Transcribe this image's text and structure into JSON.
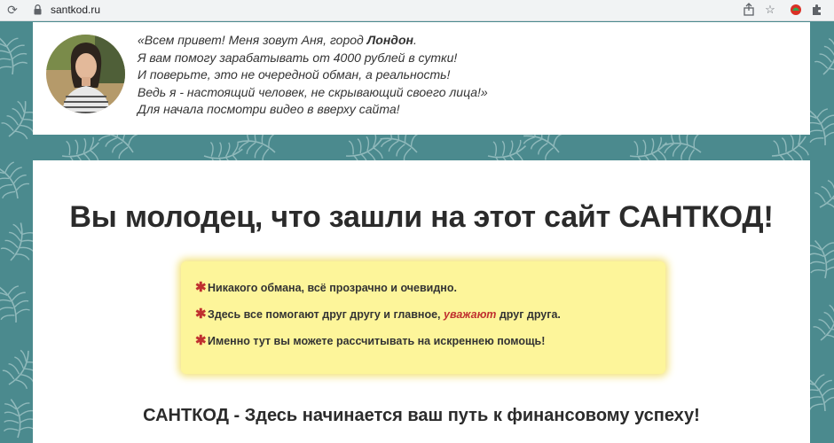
{
  "browser": {
    "url": "santkod.ru",
    "icons": [
      "reload-icon",
      "lock-icon",
      "share-icon",
      "star-icon",
      "extension-icon",
      "puzzle-icon"
    ]
  },
  "intro": {
    "line1_a": "«Всем привет! Меня зовут Аня, город ",
    "line1_city": "Лондон",
    "line1_b": ".",
    "line2": "Я вам помогу зарабатывать от 4000 рублей в сутки!",
    "line3": "И поверьте, это не очередной обман, а реальность!",
    "line4": "Ведь я - настоящий человек, не скрывающий своего лица!»",
    "line5": "Для начала посмотри видео в вверху сайта!"
  },
  "main": {
    "headline": "Вы молодец, что зашли на этот сайт САНТКОД!",
    "notice": {
      "star": "✱",
      "item1": "Никакого обмана, всё прозрачно и очевидно.",
      "item2_a": "Здесь все помогают друг другу и главное, ",
      "item2_hl": "уважают",
      "item2_b": " друг друга.",
      "item3": "Именно тут вы можете рассчитывать на искреннею помощь!"
    },
    "footer": "САНТКОД - Здесь начинается ваш путь к финансовому успеху!"
  },
  "colors": {
    "background": "#4b8a8e",
    "notice_bg": "#fdf59a",
    "accent_red": "#c0302f"
  }
}
